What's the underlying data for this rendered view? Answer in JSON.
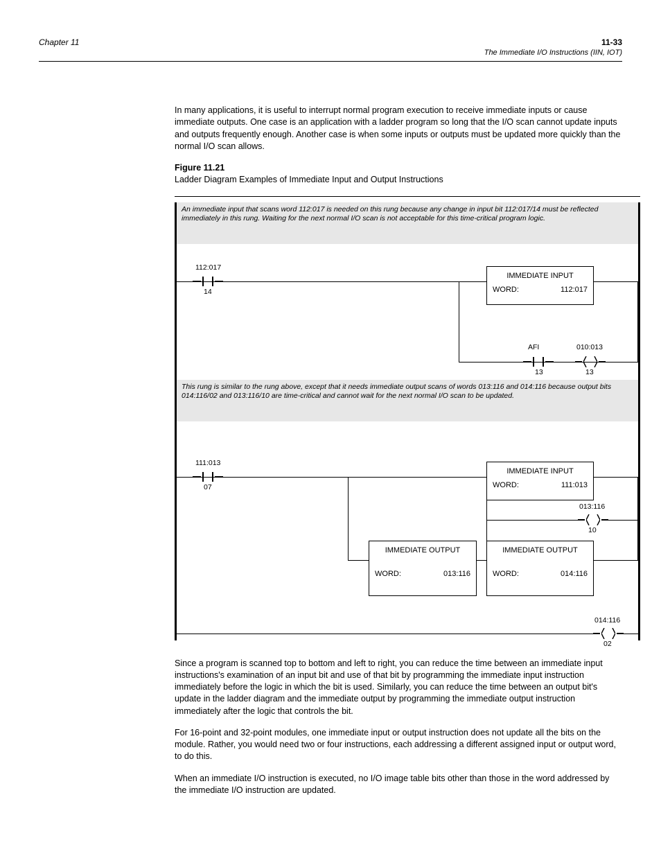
{
  "header": {
    "chapter": "Chapter 11",
    "page_number": "11-33",
    "subtitle": "The Immediate I/O Instructions (IIN, IOT)"
  },
  "body": {
    "p1": "In many applications, it is useful to interrupt normal program execution to receive immediate inputs or cause immediate outputs. One case is an application with a ladder program so long that the I/O scan cannot update inputs and outputs frequently enough. Another case is when some inputs or outputs must be updated more quickly than the normal I/O scan allows.",
    "figcap_label": "Figure 11.21",
    "figcap_text": "Ladder Diagram Examples of Immediate Input and Output Instructions"
  },
  "diagram": {
    "rung1_comment": "An immediate input that scans word 112:017 is needed on this rung because any change in input bit 112:017/14 must be reflected immediately in this rung. Waiting for the next normal I/O scan is not acceptable for this time-critical program logic.",
    "rung2_comment": "This rung is similar to the rung above, except that it needs immediate output scans of words 013:116 and 014:116 because output bits 014:116/02 and 013:116/10 are time-critical and cannot wait for the next normal I/O scan to be updated.",
    "contact1": {
      "addr": "112:017",
      "bit": "14"
    },
    "iin1": {
      "label": "IMMEDIATE INPUT",
      "word_lbl": "WORD:",
      "word_val": "112:017"
    },
    "afi1": {
      "label": "AFI",
      "addr": "",
      "bit": "13"
    },
    "coil1": {
      "addr": "010:013",
      "bit": "13"
    },
    "contact2": {
      "addr": "111:013",
      "bit": "07"
    },
    "iin2": {
      "label": "IMMEDIATE INPUT",
      "word_lbl": "WORD:",
      "word_val": "111:013"
    },
    "iot1": {
      "label": "IMMEDIATE OUTPUT",
      "word_lbl": "WORD:",
      "word_val": "013:116"
    },
    "iot2": {
      "label": "IMMEDIATE OUTPUT",
      "word_lbl": "WORD:",
      "word_val": "014:116"
    },
    "coil2": {
      "addr": "013:116",
      "bit": "10"
    },
    "coil3": {
      "addr": "014:116",
      "bit": "02"
    }
  },
  "trailer": {
    "p1": "Since a program is scanned top to bottom and left to right, you can reduce the time between an immediate input instructions's examination of an input bit and use of that bit by programming the immediate input instruction immediately before the logic in which the bit is used. Similarly, you can reduce the time between an output bit's update in the ladder diagram and the immediate output by programming the immediate output instruction immediately after the logic that controls the bit.",
    "p2": "For 16-point and 32-point modules, one immediate input or output instruction does not update all the bits on the module. Rather, you would need two or four instructions, each addressing a different assigned input or output word, to do this.",
    "p3": "When an immediate I/O instruction is executed, no I/O image table bits other than those in the word addressed by the immediate I/O instruction are updated."
  }
}
